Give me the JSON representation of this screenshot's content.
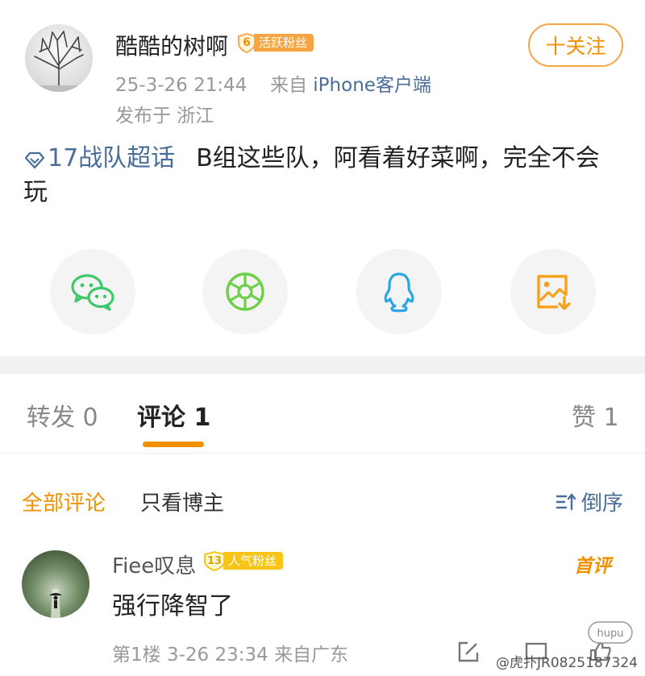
{
  "post": {
    "username": "酷酷的树啊",
    "fan_level": "6",
    "fan_badge": "活跃粉丝",
    "time": "25-3-26 21:44",
    "source_prefix": "来自",
    "source": "iPhone客户端",
    "location": "发布于 浙江",
    "follow_label": "十关注",
    "topic": "17战队超话",
    "text": "B组这些队，阿看着好菜啊，完全不会玩"
  },
  "share": {
    "items": [
      {
        "icon": "wechat-icon"
      },
      {
        "icon": "moments-icon"
      },
      {
        "icon": "qq-icon"
      },
      {
        "icon": "save-image-icon"
      }
    ]
  },
  "tabs": {
    "repost": "转发 0",
    "comment": "评论 1",
    "like": "赞 1"
  },
  "comments_header": {
    "all": "全部评论",
    "owner_only": "只看博主",
    "sort": "倒序"
  },
  "comment": {
    "username": "Fiee叹息",
    "fan_level": "13",
    "fan_badge": "人气粉丝",
    "first_badge": "首评",
    "text": "强行降智了",
    "meta": "第1楼 3-26 23:34 来自广东"
  },
  "watermark": {
    "text": "@虎扑JR0825187324",
    "logo": "hupu"
  },
  "colors": {
    "accent": "#f29100",
    "link": "#4a6d98",
    "wechat": "#3fc86b",
    "moments": "#6fcf4b",
    "qq": "#2aa6e8",
    "save": "#f7a21b"
  }
}
